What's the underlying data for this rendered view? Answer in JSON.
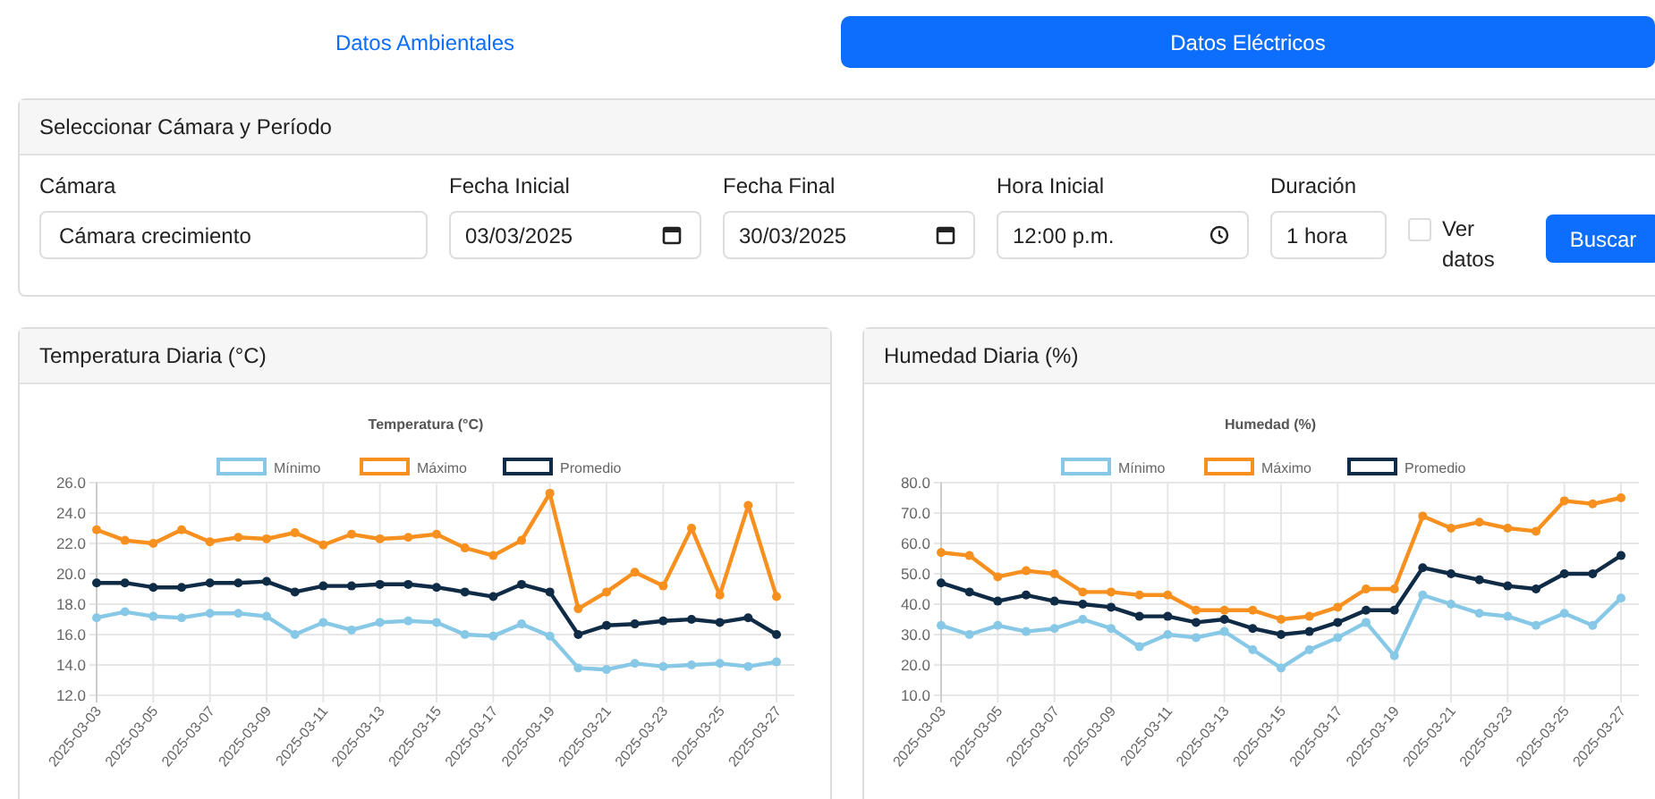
{
  "tabs": [
    {
      "label": "Datos Ambientales",
      "selected": false
    },
    {
      "label": "Datos Eléctricos",
      "selected": true
    }
  ],
  "filter": {
    "title": "Seleccionar Cámara y Período",
    "fields": [
      {
        "label": "Cámara",
        "value": "Cámara crecimiento",
        "kind": "text"
      },
      {
        "label": "Fecha Inicial",
        "value": "03/03/2025",
        "kind": "date"
      },
      {
        "label": "Fecha Final",
        "value": "30/03/2025",
        "kind": "date"
      },
      {
        "label": "Hora Inicial",
        "value": "12:00 p.m.",
        "kind": "time"
      },
      {
        "label": "Duración",
        "value": "1 hora",
        "kind": "short"
      }
    ],
    "checkbox": {
      "label": "Ver datos",
      "checked": false
    },
    "button": "Buscar"
  },
  "charts": [
    {
      "card_title": "Temperatura Diaria (°C)",
      "chart_data": {
        "type": "line",
        "title": "Temperatura (°C)",
        "grid": true,
        "legend": true,
        "categories": [
          "2025-03-03",
          null,
          "2025-03-05",
          null,
          "2025-03-07",
          null,
          "2025-03-09",
          null,
          "2025-03-11",
          null,
          "2025-03-13",
          null,
          "2025-03-15",
          null,
          "2025-03-17",
          null,
          "2025-03-19",
          null,
          "2025-03-21",
          null,
          "2025-03-23",
          null,
          "2025-03-25",
          null,
          "2025-03-27"
        ],
        "ylim": [
          12,
          26
        ],
        "yticks": [
          {
            "value": 12,
            "label": "12.0"
          },
          {
            "value": 14,
            "label": "14.0"
          },
          {
            "value": 16,
            "label": "16.0"
          },
          {
            "value": 18,
            "label": "18.0"
          },
          {
            "value": 20,
            "label": "20.0"
          },
          {
            "value": 22,
            "label": "22.0"
          },
          {
            "value": 24,
            "label": "24.0"
          },
          {
            "value": 26,
            "label": "26.0"
          }
        ],
        "series": [
          {
            "name": "Mínimo",
            "color": "#87c8e6",
            "marker": "circle",
            "values": [
              17.1,
              17.5,
              17.2,
              17.1,
              17.4,
              17.4,
              17.2,
              16.0,
              16.8,
              16.3,
              16.8,
              16.9,
              16.8,
              16.0,
              15.9,
              16.7,
              15.9,
              13.8,
              13.7,
              14.1,
              13.9,
              14.0,
              14.1,
              13.9,
              14.2
            ]
          },
          {
            "name": "Máximo",
            "color": "#f7901e",
            "marker": "circle",
            "values": [
              22.9,
              22.2,
              22.0,
              22.9,
              22.1,
              22.4,
              22.3,
              22.7,
              21.9,
              22.6,
              22.3,
              22.4,
              22.6,
              21.7,
              21.2,
              22.2,
              25.3,
              17.7,
              18.8,
              20.1,
              19.2,
              23.0,
              18.6,
              24.5,
              18.5
            ]
          },
          {
            "name": "Promedio",
            "color": "#0f2b46",
            "marker": "circle",
            "values": [
              19.4,
              19.4,
              19.1,
              19.1,
              19.4,
              19.4,
              19.5,
              18.8,
              19.2,
              19.2,
              19.3,
              19.3,
              19.1,
              18.8,
              18.5,
              19.3,
              18.8,
              16.0,
              16.6,
              16.7,
              16.9,
              17.0,
              16.8,
              17.1,
              16.0
            ]
          }
        ]
      }
    },
    {
      "card_title": "Humedad Diaria (%)",
      "chart_data": {
        "type": "line",
        "title": "Humedad (%)",
        "grid": true,
        "legend": true,
        "categories": [
          "2025-03-03",
          null,
          "2025-03-05",
          null,
          "2025-03-07",
          null,
          "2025-03-09",
          null,
          "2025-03-11",
          null,
          "2025-03-13",
          null,
          "2025-03-15",
          null,
          "2025-03-17",
          null,
          "2025-03-19",
          null,
          "2025-03-21",
          null,
          "2025-03-23",
          null,
          "2025-03-25",
          null,
          "2025-03-27"
        ],
        "ylim": [
          10,
          80
        ],
        "yticks": [
          {
            "value": 10,
            "label": "10.0"
          },
          {
            "value": 20,
            "label": "20.0"
          },
          {
            "value": 30,
            "label": "30.0"
          },
          {
            "value": 40,
            "label": "40.0"
          },
          {
            "value": 50,
            "label": "50.0"
          },
          {
            "value": 60,
            "label": "60.0"
          },
          {
            "value": 70,
            "label": "70.0"
          },
          {
            "value": 80,
            "label": "80.0"
          }
        ],
        "series": [
          {
            "name": "Mínimo",
            "color": "#87c8e6",
            "marker": "circle",
            "values": [
              33,
              30,
              33,
              31,
              32,
              35,
              32,
              26,
              30,
              29,
              31,
              25,
              19,
              25,
              29,
              34,
              23,
              43,
              40,
              37,
              36,
              33,
              37,
              33,
              42
            ]
          },
          {
            "name": "Máximo",
            "color": "#f7901e",
            "marker": "circle",
            "values": [
              57,
              56,
              49,
              51,
              50,
              44,
              44,
              43,
              43,
              38,
              38,
              38,
              35,
              36,
              39,
              45,
              45,
              69,
              65,
              67,
              65,
              64,
              74,
              73,
              75
            ]
          },
          {
            "name": "Promedio",
            "color": "#0f2b46",
            "marker": "circle",
            "values": [
              47,
              44,
              41,
              43,
              41,
              40,
              39,
              36,
              36,
              34,
              35,
              32,
              30,
              31,
              34,
              38,
              38,
              52,
              50,
              48,
              46,
              45,
              50,
              50,
              56
            ]
          }
        ]
      }
    }
  ]
}
